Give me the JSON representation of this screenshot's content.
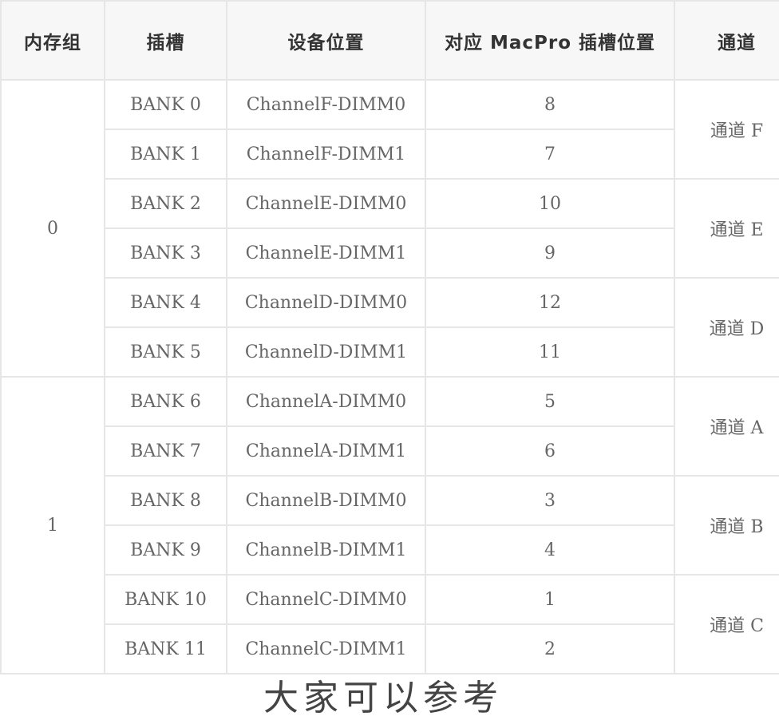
{
  "table": {
    "headers": [
      "内存组",
      "插槽",
      "设备位置",
      "对应 MacPro 插槽位置",
      "通道"
    ],
    "groups": [
      "0",
      "1"
    ],
    "rows": [
      {
        "slot": "BANK 0",
        "device": "ChannelF-DIMM0",
        "macpro": "8"
      },
      {
        "slot": "BANK 1",
        "device": "ChannelF-DIMM1",
        "macpro": "7"
      },
      {
        "slot": "BANK 2",
        "device": "ChannelE-DIMM0",
        "macpro": "10"
      },
      {
        "slot": "BANK 3",
        "device": "ChannelE-DIMM1",
        "macpro": "9"
      },
      {
        "slot": "BANK 4",
        "device": "ChannelD-DIMM0",
        "macpro": "12"
      },
      {
        "slot": "BANK 5",
        "device": "ChannelD-DIMM1",
        "macpro": "11"
      },
      {
        "slot": "BANK 6",
        "device": "ChannelA-DIMM0",
        "macpro": "5"
      },
      {
        "slot": "BANK 7",
        "device": "ChannelA-DIMM1",
        "macpro": "6"
      },
      {
        "slot": "BANK 8",
        "device": "ChannelB-DIMM0",
        "macpro": "3"
      },
      {
        "slot": "BANK 9",
        "device": "ChannelB-DIMM1",
        "macpro": "4"
      },
      {
        "slot": "BANK 10",
        "device": "ChannelC-DIMM0",
        "macpro": "1"
      },
      {
        "slot": "BANK 11",
        "device": "ChannelC-DIMM1",
        "macpro": "2"
      }
    ],
    "channels": [
      "通道 F",
      "通道 E",
      "通道 D",
      "通道 A",
      "通道 B",
      "通道 C"
    ]
  },
  "footer": {
    "text": "大家可以参考"
  }
}
